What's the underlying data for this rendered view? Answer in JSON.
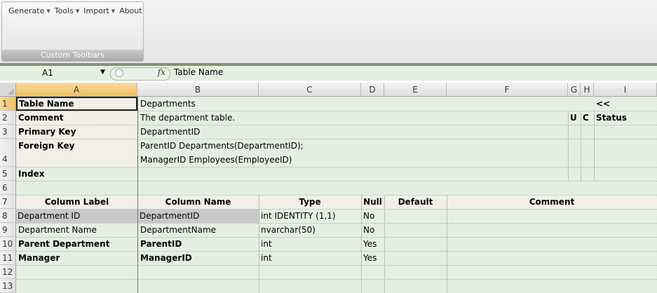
{
  "ribbon": {
    "menu": [
      {
        "label": "Generate",
        "has_caret": true
      },
      {
        "label": "Tools",
        "has_caret": true
      },
      {
        "label": "Import",
        "has_caret": true
      },
      {
        "label": "About",
        "has_caret": false
      }
    ],
    "group_caption": "Custom Toolbars"
  },
  "formula_bar": {
    "name_box": "A1",
    "fx_icon": "fx",
    "value": "Table Name"
  },
  "columns": [
    "A",
    "B",
    "C",
    "D",
    "E",
    "F",
    "G",
    "H",
    "I"
  ],
  "rows": [
    "1",
    "2",
    "3",
    "4",
    "5",
    "6",
    "7",
    "8",
    "9",
    "10",
    "11",
    "12",
    "13"
  ],
  "sheet": {
    "r1": {
      "label": "Table Name",
      "value": "Departments",
      "toggle": "<<"
    },
    "r2": {
      "label": "Comment",
      "value": "The department table.",
      "u": "U",
      "c": "C",
      "status": "Status"
    },
    "r3": {
      "label": "Primary Key",
      "value": "DepartmentID"
    },
    "r4": {
      "label": "Foreign Key",
      "value_line1": "ParentID Departments(DepartmentID);",
      "value_line2": "ManagerID Employees(EmployeeID)"
    },
    "r5": {
      "label": "Index"
    },
    "headers": {
      "column_label": "Column Label",
      "column_name": "Column Name",
      "type": "Type",
      "null": "Null",
      "default": "Default",
      "comment": "Comment"
    },
    "table_rows": [
      {
        "label": "Department ID",
        "name": "DepartmentID",
        "type": "int IDENTITY (1,1)",
        "null": "No",
        "bold": false
      },
      {
        "label": "Department Name",
        "name": "DepartmentName",
        "type": "nvarchar(50)",
        "null": "No",
        "bold": false
      },
      {
        "label": "Parent Department",
        "name": "ParentID",
        "type": "int",
        "null": "Yes",
        "bold": true
      },
      {
        "label": "Manager",
        "name": "ManagerID",
        "type": "int",
        "null": "Yes",
        "bold": true
      }
    ]
  },
  "colors": {
    "row_green": "#e3efdf",
    "label_cream": "#f2efe6",
    "selected_gray": "#c8c8c8",
    "header_highlight": "#f1c15f"
  }
}
